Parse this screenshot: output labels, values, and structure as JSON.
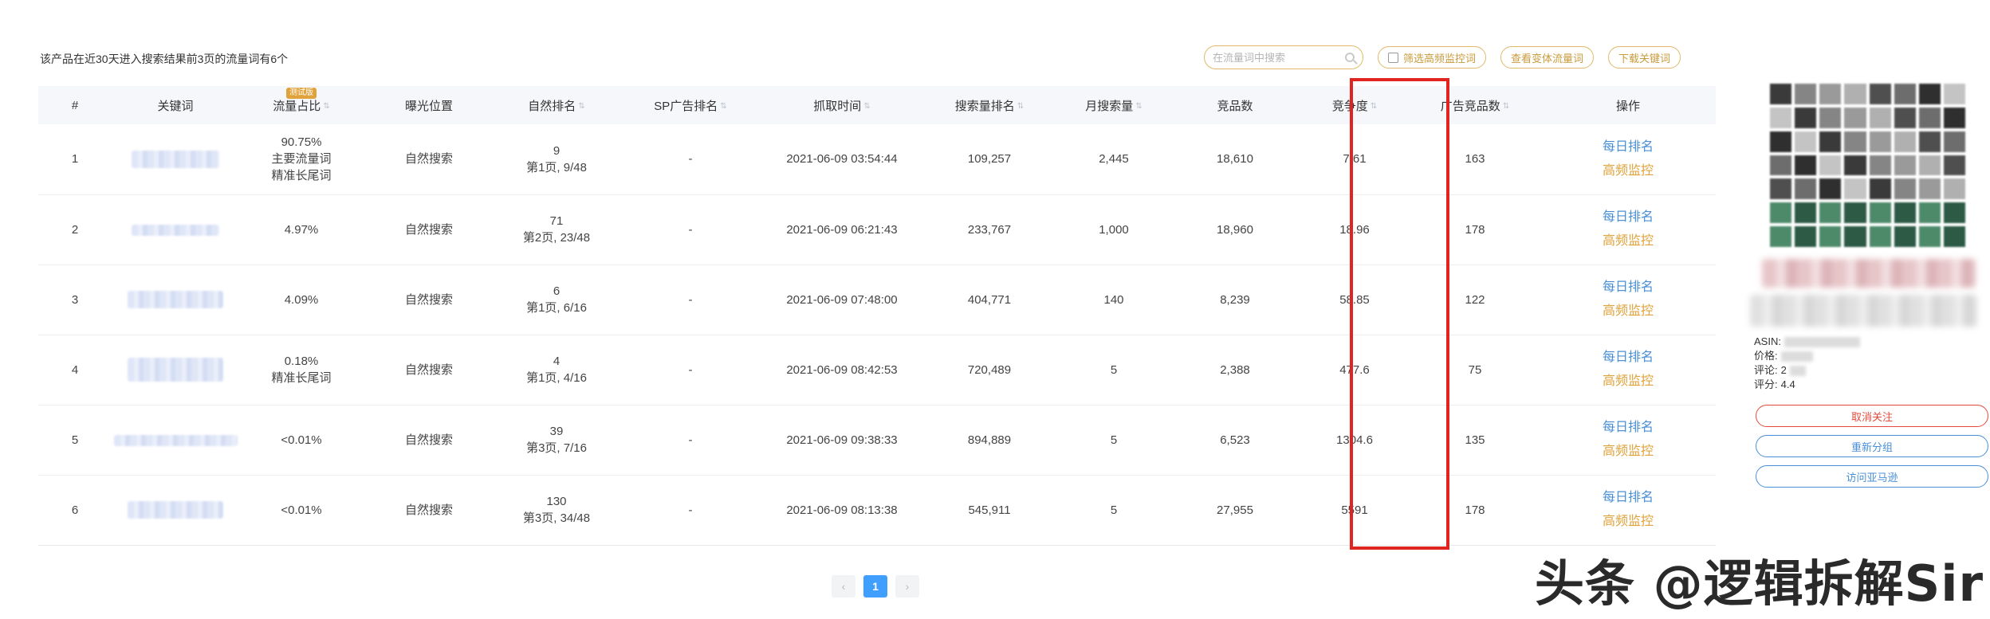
{
  "summary": "该产品在近30天进入搜索结果前3页的流量词有6个",
  "tools": {
    "search_placeholder": "在流量词中搜索",
    "filter_label": "筛选高频监控词",
    "variant_label": "查看变体流量词",
    "download_label": "下载关键词"
  },
  "table": {
    "beta_badge": "测试版",
    "headers": [
      "#",
      "关键词",
      "流量占比",
      "曝光位置",
      "自然排名",
      "SP广告排名",
      "抓取时间",
      "搜索量排名",
      "月搜索量",
      "竞品数",
      "竞争度",
      "广告竞品数",
      "操作"
    ],
    "rows": [
      {
        "idx": "1",
        "share": "90.75%",
        "tag1": "主要流量词",
        "tag2": "精准长尾词",
        "exposure": "自然搜索",
        "rank": "9",
        "rank_page": "第1页, 9/48",
        "sp": "-",
        "time": "2021-06-09 03:54:44",
        "vol_rank": "109,257",
        "monthly": "2,445",
        "competitors": "18,610",
        "competition": "7.61",
        "ad_competitors": "163",
        "op1": "每日排名",
        "op2": "高频监控"
      },
      {
        "idx": "2",
        "share": "4.97%",
        "tag1": "",
        "tag2": "",
        "exposure": "自然搜索",
        "rank": "71",
        "rank_page": "第2页, 23/48",
        "sp": "-",
        "time": "2021-06-09 06:21:43",
        "vol_rank": "233,767",
        "monthly": "1,000",
        "competitors": "18,960",
        "competition": "18.96",
        "ad_competitors": "178",
        "op1": "每日排名",
        "op2": "高频监控"
      },
      {
        "idx": "3",
        "share": "4.09%",
        "tag1": "",
        "tag2": "",
        "exposure": "自然搜索",
        "rank": "6",
        "rank_page": "第1页, 6/16",
        "sp": "-",
        "time": "2021-06-09 07:48:00",
        "vol_rank": "404,771",
        "monthly": "140",
        "competitors": "8,239",
        "competition": "58.85",
        "ad_competitors": "122",
        "op1": "每日排名",
        "op2": "高频监控"
      },
      {
        "idx": "4",
        "share": "0.18%",
        "tag1": "精准长尾词",
        "tag2": "",
        "exposure": "自然搜索",
        "rank": "4",
        "rank_page": "第1页, 4/16",
        "sp": "-",
        "time": "2021-06-09 08:42:53",
        "vol_rank": "720,489",
        "monthly": "5",
        "competitors": "2,388",
        "competition": "477.6",
        "ad_competitors": "75",
        "op1": "每日排名",
        "op2": "高频监控"
      },
      {
        "idx": "5",
        "share": "<0.01%",
        "tag1": "",
        "tag2": "",
        "exposure": "自然搜索",
        "rank": "39",
        "rank_page": "第3页, 7/16",
        "sp": "-",
        "time": "2021-06-09 09:38:33",
        "vol_rank": "894,889",
        "monthly": "5",
        "competitors": "6,523",
        "competition": "1304.6",
        "ad_competitors": "135",
        "op1": "每日排名",
        "op2": "高频监控"
      },
      {
        "idx": "6",
        "share": "<0.01%",
        "tag1": "",
        "tag2": "",
        "exposure": "自然搜索",
        "rank": "130",
        "rank_page": "第3页, 34/48",
        "sp": "-",
        "time": "2021-06-09 08:13:38",
        "vol_rank": "545,911",
        "monthly": "5",
        "competitors": "27,955",
        "competition": "5591",
        "ad_competitors": "178",
        "op1": "每日排名",
        "op2": "高频监控"
      }
    ]
  },
  "pager": {
    "prev": "‹",
    "current": "1",
    "next": "›"
  },
  "product": {
    "asin_label": "ASIN:",
    "price_label": "价格:",
    "review_label": "评论:",
    "review_value": "2",
    "rating_label": "评分:",
    "rating_value": "4.4",
    "unfollow": "取消关注",
    "regroup": "重新分组",
    "visit_amazon": "访问亚马逊"
  },
  "watermark": "头条 @逻辑拆解Sir",
  "colors": {
    "accent_blue": "#409eff",
    "link_blue": "#4a8fd6",
    "orange": "#e0a23a",
    "highlight_red": "#e0241f"
  }
}
